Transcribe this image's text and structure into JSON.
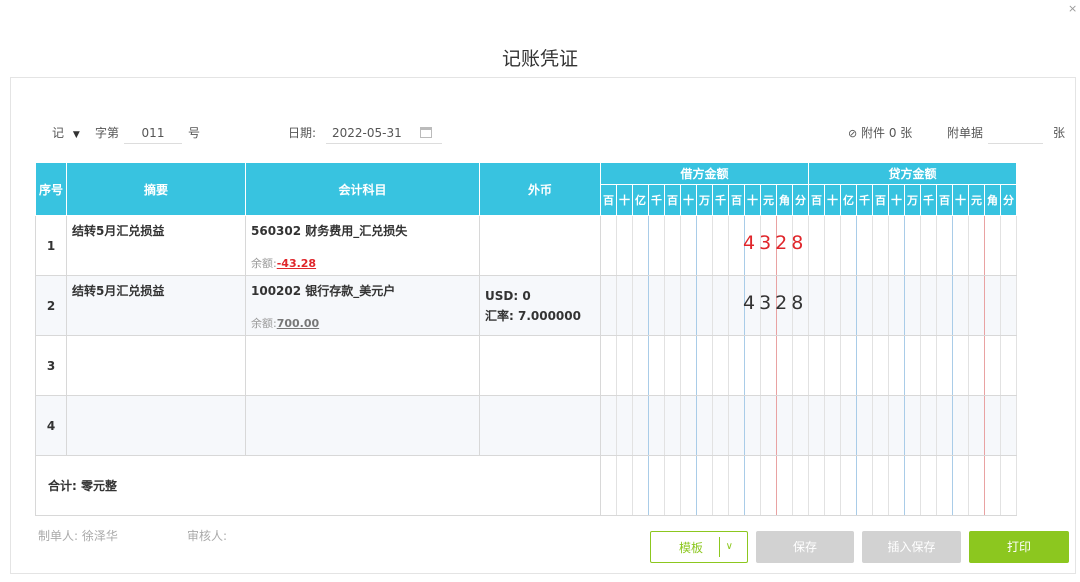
{
  "dialog": {
    "title": "记账凭证",
    "close": "×"
  },
  "header": {
    "voucher_type": "记",
    "zi_label": "字第",
    "number": "011",
    "hao_label": "号",
    "date_label": "日期:",
    "date_value": "2022-05-31",
    "attachment_label": "附件 0 张",
    "receipts_label": "附单据",
    "receipts_value": "",
    "zhang_label": "张"
  },
  "table": {
    "headers": {
      "seq": "序号",
      "summary": "摘要",
      "account": "会计科目",
      "fx": "外币",
      "debit": "借方金额",
      "credit": "贷方金额"
    },
    "digit_labels": [
      "百",
      "十",
      "亿",
      "千",
      "百",
      "十",
      "万",
      "千",
      "百",
      "十",
      "元",
      "角",
      "分"
    ],
    "rows": [
      {
        "seq": "1",
        "summary": "结转5月汇兑损益",
        "account": "560302 财务费用_汇兑损失",
        "balance_label": "余额:",
        "balance": "-43.28",
        "fx_line1": "",
        "fx_line2": "",
        "debit": "4328"
      },
      {
        "seq": "2",
        "summary": "结转5月汇兑损益",
        "account": "100202 银行存款_美元户",
        "balance_label": "余额:",
        "balance": "700.00",
        "fx_line1": "USD: 0",
        "fx_line2": "汇率: 7.000000",
        "debit": "4328"
      },
      {
        "seq": "3",
        "summary": "",
        "account": "",
        "balance_label": "",
        "balance": "",
        "fx_line1": "",
        "fx_line2": "",
        "debit": ""
      },
      {
        "seq": "4",
        "summary": "",
        "account": "",
        "balance_label": "",
        "balance": "",
        "fx_line1": "",
        "fx_line2": "",
        "debit": ""
      }
    ],
    "total_label": "合计:",
    "total_value": "零元整"
  },
  "footer": {
    "maker_label": "制单人:",
    "maker": "徐泽华",
    "reviewer_label": "审核人:",
    "template_btn": "模板",
    "save_btn": "保存",
    "insert_save_btn": "插入保存",
    "print_btn": "打印"
  },
  "colors": {
    "header_bg": "#38c3e0",
    "primary_green": "#8cc71f",
    "disabled_gray": "#d2d2d2",
    "red": "#e0262b"
  }
}
